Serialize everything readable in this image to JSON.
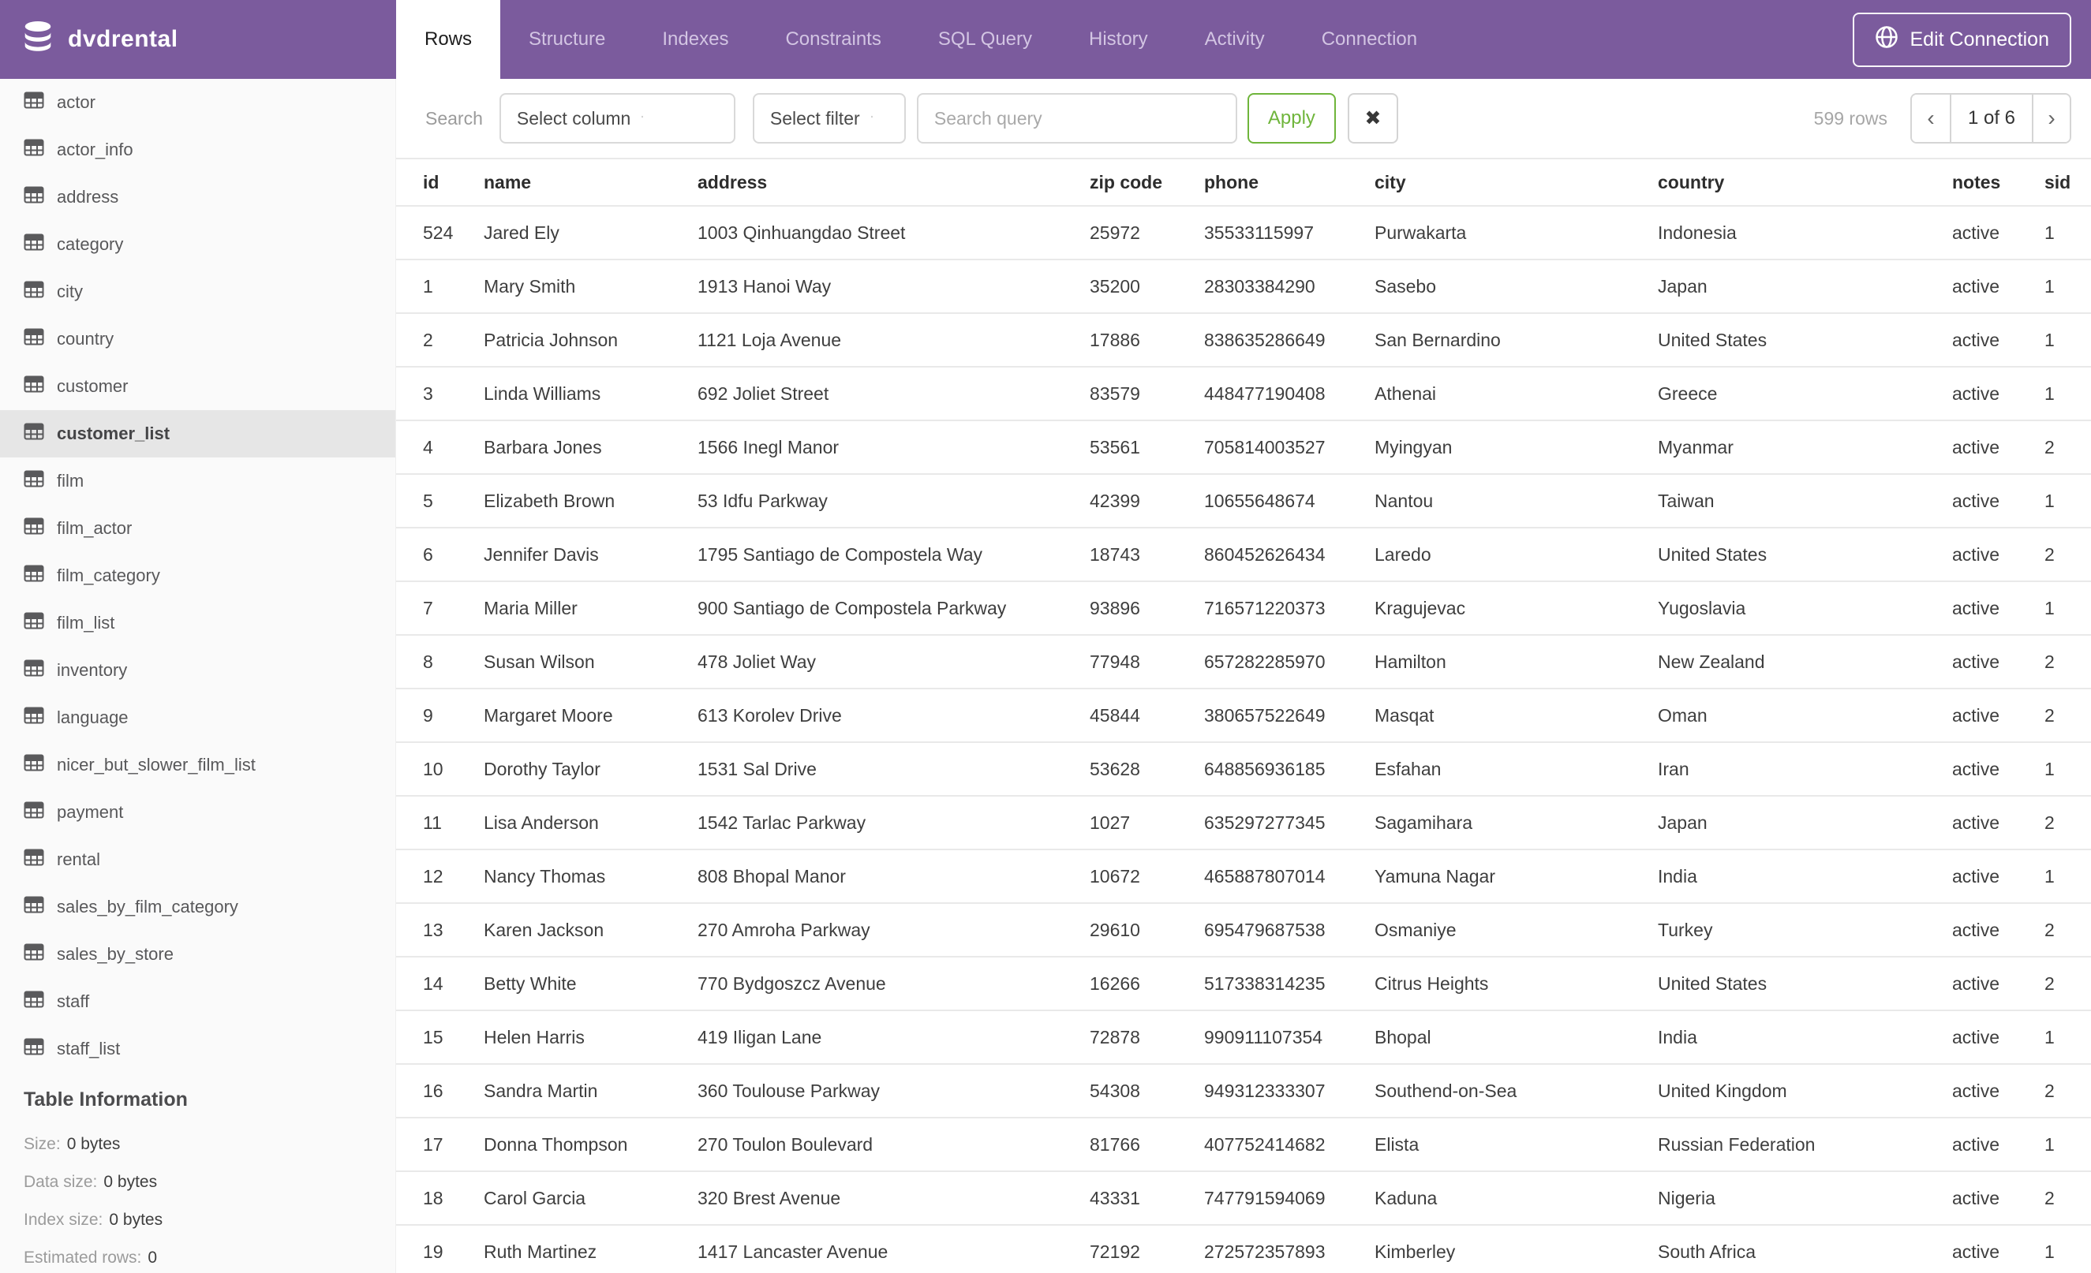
{
  "colors": {
    "brand_purple": "#7b5b9d",
    "accent_green": "#6fb53b",
    "selected_gray": "#e6e6e6"
  },
  "topbar": {
    "database": "dvdrental",
    "tabs": [
      "Rows",
      "Structure",
      "Indexes",
      "Constraints",
      "SQL Query",
      "History",
      "Activity",
      "Connection"
    ],
    "active_tab": "Rows",
    "edit_connection_label": "Edit Connection"
  },
  "sidebar": {
    "tables": [
      "actor",
      "actor_info",
      "address",
      "category",
      "city",
      "country",
      "customer",
      "customer_list",
      "film",
      "film_actor",
      "film_category",
      "film_list",
      "inventory",
      "language",
      "nicer_but_slower_film_list",
      "payment",
      "rental",
      "sales_by_film_category",
      "sales_by_store",
      "staff",
      "staff_list"
    ],
    "selected_table": "customer_list",
    "table_information": {
      "title": "Table Information",
      "items": [
        {
          "label": "Size:",
          "value": "0 bytes"
        },
        {
          "label": "Data size:",
          "value": "0 bytes"
        },
        {
          "label": "Index size:",
          "value": "0 bytes"
        },
        {
          "label": "Estimated rows:",
          "value": "0"
        }
      ]
    }
  },
  "toolbar": {
    "search_label": "Search",
    "column_select_value": "Select column",
    "filter_select_value": "Select filter",
    "query_placeholder": "Search query",
    "query_value": "",
    "apply_label": "Apply",
    "clear_label": "✖",
    "row_count": "599 rows",
    "pager": {
      "prev": "‹",
      "page": "1 of 6",
      "next": "›"
    }
  },
  "table": {
    "columns": [
      "id",
      "name",
      "address",
      "zip code",
      "phone",
      "city",
      "country",
      "notes",
      "sid"
    ],
    "rows": [
      [
        524,
        "Jared Ely",
        "1003 Qinhuangdao Street",
        "25972",
        "35533115997",
        "Purwakarta",
        "Indonesia",
        "active",
        1
      ],
      [
        1,
        "Mary Smith",
        "1913 Hanoi Way",
        "35200",
        "28303384290",
        "Sasebo",
        "Japan",
        "active",
        1
      ],
      [
        2,
        "Patricia Johnson",
        "1121 Loja Avenue",
        "17886",
        "838635286649",
        "San Bernardino",
        "United States",
        "active",
        1
      ],
      [
        3,
        "Linda Williams",
        "692 Joliet Street",
        "83579",
        "448477190408",
        "Athenai",
        "Greece",
        "active",
        1
      ],
      [
        4,
        "Barbara Jones",
        "1566 Inegl Manor",
        "53561",
        "705814003527",
        "Myingyan",
        "Myanmar",
        "active",
        2
      ],
      [
        5,
        "Elizabeth Brown",
        "53 Idfu Parkway",
        "42399",
        "10655648674",
        "Nantou",
        "Taiwan",
        "active",
        1
      ],
      [
        6,
        "Jennifer Davis",
        "1795 Santiago de Compostela Way",
        "18743",
        "860452626434",
        "Laredo",
        "United States",
        "active",
        2
      ],
      [
        7,
        "Maria Miller",
        "900 Santiago de Compostela Parkway",
        "93896",
        "716571220373",
        "Kragujevac",
        "Yugoslavia",
        "active",
        1
      ],
      [
        8,
        "Susan Wilson",
        "478 Joliet Way",
        "77948",
        "657282285970",
        "Hamilton",
        "New Zealand",
        "active",
        2
      ],
      [
        9,
        "Margaret Moore",
        "613 Korolev Drive",
        "45844",
        "380657522649",
        "Masqat",
        "Oman",
        "active",
        2
      ],
      [
        10,
        "Dorothy Taylor",
        "1531 Sal Drive",
        "53628",
        "648856936185",
        "Esfahan",
        "Iran",
        "active",
        1
      ],
      [
        11,
        "Lisa Anderson",
        "1542 Tarlac Parkway",
        "1027",
        "635297277345",
        "Sagamihara",
        "Japan",
        "active",
        2
      ],
      [
        12,
        "Nancy Thomas",
        "808 Bhopal Manor",
        "10672",
        "465887807014",
        "Yamuna Nagar",
        "India",
        "active",
        1
      ],
      [
        13,
        "Karen Jackson",
        "270 Amroha Parkway",
        "29610",
        "695479687538",
        "Osmaniye",
        "Turkey",
        "active",
        2
      ],
      [
        14,
        "Betty White",
        "770 Bydgoszcz Avenue",
        "16266",
        "517338314235",
        "Citrus Heights",
        "United States",
        "active",
        2
      ],
      [
        15,
        "Helen Harris",
        "419 Iligan Lane",
        "72878",
        "990911107354",
        "Bhopal",
        "India",
        "active",
        1
      ],
      [
        16,
        "Sandra Martin",
        "360 Toulouse Parkway",
        "54308",
        "949312333307",
        "Southend-on-Sea",
        "United Kingdom",
        "active",
        2
      ],
      [
        17,
        "Donna Thompson",
        "270 Toulon Boulevard",
        "81766",
        "407752414682",
        "Elista",
        "Russian Federation",
        "active",
        1
      ],
      [
        18,
        "Carol Garcia",
        "320 Brest Avenue",
        "43331",
        "747791594069",
        "Kaduna",
        "Nigeria",
        "active",
        2
      ],
      [
        19,
        "Ruth Martinez",
        "1417 Lancaster Avenue",
        "72192",
        "272572357893",
        "Kimberley",
        "South Africa",
        "active",
        1
      ]
    ]
  }
}
